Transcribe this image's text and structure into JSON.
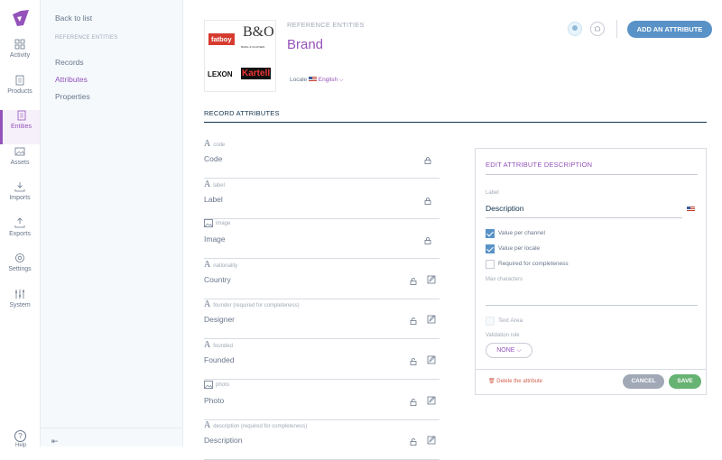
{
  "nav": {
    "items": [
      {
        "label": "Activity",
        "icon": "activity-icon"
      },
      {
        "label": "Products",
        "icon": "products-icon"
      },
      {
        "label": "Entities",
        "icon": "entities-icon"
      },
      {
        "label": "Assets",
        "icon": "assets-icon"
      },
      {
        "label": "Imports",
        "icon": "imports-icon"
      },
      {
        "label": "Exports",
        "icon": "exports-icon"
      },
      {
        "label": "Settings",
        "icon": "settings-icon"
      },
      {
        "label": "System",
        "icon": "system-icon"
      }
    ],
    "help_label": "Help",
    "accent": "#9452ba"
  },
  "column": {
    "back": "Back to list",
    "section": "REFERENCE ENTITIES",
    "links": [
      "Records",
      "Attributes",
      "Properties"
    ],
    "active_link": "Attributes"
  },
  "header": {
    "subtitle": "REFERENCE ENTITIES",
    "title": "Brand",
    "locale_label": "Locale",
    "locale_value": "English",
    "add_button": "ADD AN ATTRIBUTE",
    "thumb": {
      "brands": [
        "fatboy",
        "B&O",
        "BANG & OLUFSEN",
        "LEXON",
        "Kartell"
      ]
    }
  },
  "records": {
    "title": "RECORD ATTRIBUTES",
    "attributes": [
      {
        "code": "code",
        "name": "Code",
        "type": "text",
        "locked": true,
        "editable": false
      },
      {
        "code": "label",
        "name": "Label",
        "type": "text",
        "locked": true,
        "editable": false
      },
      {
        "code": "image",
        "name": "Image",
        "type": "image",
        "locked": true,
        "editable": false
      },
      {
        "code": "nationality",
        "name": "Country",
        "type": "text",
        "locked": false,
        "editable": true
      },
      {
        "code": "founder (required for completeness)",
        "name": "Designer",
        "type": "text",
        "locked": false,
        "editable": true
      },
      {
        "code": "founded",
        "name": "Founded",
        "type": "text",
        "locked": false,
        "editable": true
      },
      {
        "code": "photo",
        "name": "Photo",
        "type": "image",
        "locked": false,
        "editable": true
      },
      {
        "code": "description (required for completeness)",
        "name": "Description",
        "type": "text",
        "locked": false,
        "editable": true
      }
    ]
  },
  "panel": {
    "title": "EDIT ATTRIBUTE DESCRIPTION",
    "label_caption": "Label",
    "label_value": "Description",
    "value_per_channel": "Value per channel",
    "value_per_locale": "Value per locale",
    "required": "Required for completeness",
    "max_chars": "Max characters",
    "text_area": "Text Area",
    "validation_rule": "Validation rule",
    "validation_value": "NONE",
    "delete": "Delete the attribute",
    "cancel": "CANCEL",
    "save": "SAVE"
  }
}
